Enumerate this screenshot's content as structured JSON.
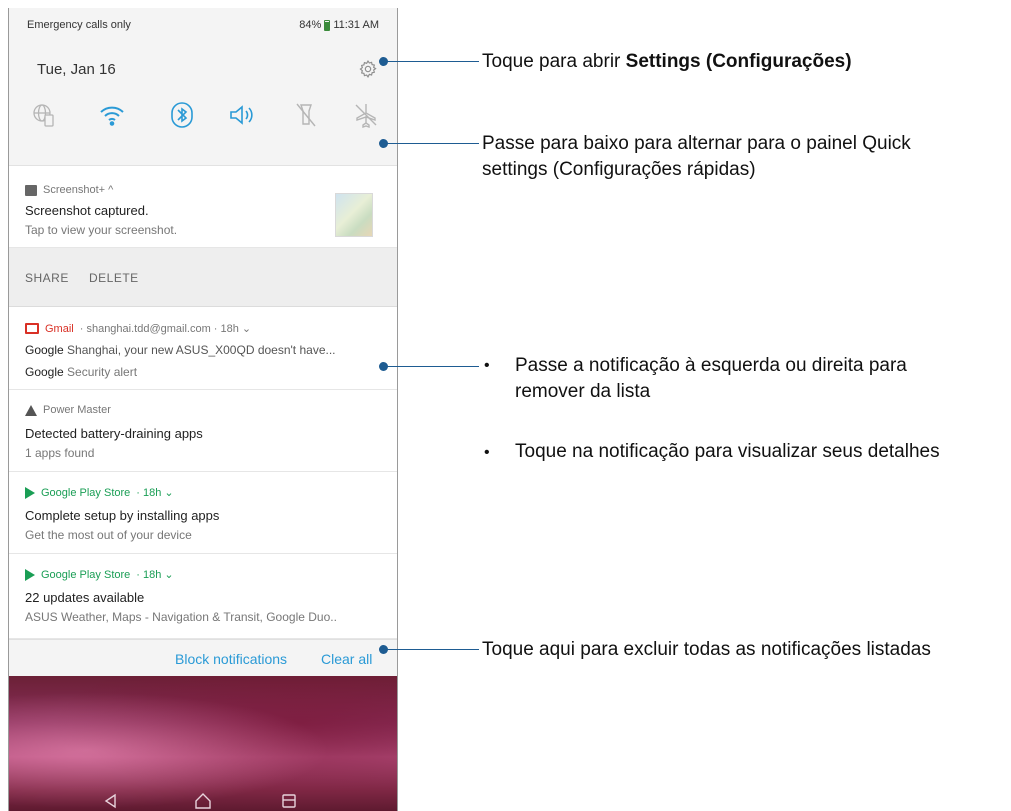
{
  "status_bar": {
    "carrier": "Emergency calls only",
    "battery": "84%",
    "time": "11:31 AM"
  },
  "quick_settings": {
    "date": "Tue, Jan 16",
    "tiles": [
      "globe-icon",
      "wifi-icon",
      "bluetooth-icon",
      "volume-icon",
      "flashlight-icon",
      "airplane-icon"
    ]
  },
  "notifications": [
    {
      "app": "Screenshot+ ^",
      "title": "Screenshot captured.",
      "text": "Tap to view your screenshot.",
      "actions": [
        "SHARE",
        "DELETE"
      ]
    },
    {
      "app": "Gmail",
      "meta": "· shanghai.tdd@gmail.com · 18h ⌄",
      "line1_bold": "Google",
      "line1": " Shanghai, your new ASUS_X00QD doesn't have...",
      "line2_bold": "Google",
      "line2": " Security alert"
    },
    {
      "app": "Power Master",
      "title": "Detected battery-draining apps",
      "text": "1 apps found"
    },
    {
      "app": "Google Play Store",
      "meta": "· 18h ⌄",
      "title": "Complete setup by installing apps",
      "text": "Get the most out of your device"
    },
    {
      "app": "Google Play Store",
      "meta": "· 18h ⌄",
      "title": "22 updates available",
      "text": "ASUS Weather, Maps - Navigation & Transit, Google Duo.."
    }
  ],
  "footer": {
    "block": "Block notifications",
    "clear": "Clear all"
  },
  "callouts": {
    "settings_prefix": "Toque para abrir ",
    "settings_bold": "Settings (Configurações)",
    "swipe_down_1": "Passe para baixo para alternar para o painel Quick",
    "swipe_down_2": "settings (Configurações rápidas)",
    "bullet1_1": "Passe a notificação à esquerda ou direita para",
    "bullet1_2": "remover da lista",
    "bullet2": "Toque na notificação para visualizar seus detalhes",
    "clear_all": "Toque aqui para excluir todas as notificações listadas"
  },
  "colors": {
    "accent_link": "#2a9ad6",
    "callout": "#1e5c92",
    "gmail": "#d93025",
    "play": "#1a9e55"
  }
}
